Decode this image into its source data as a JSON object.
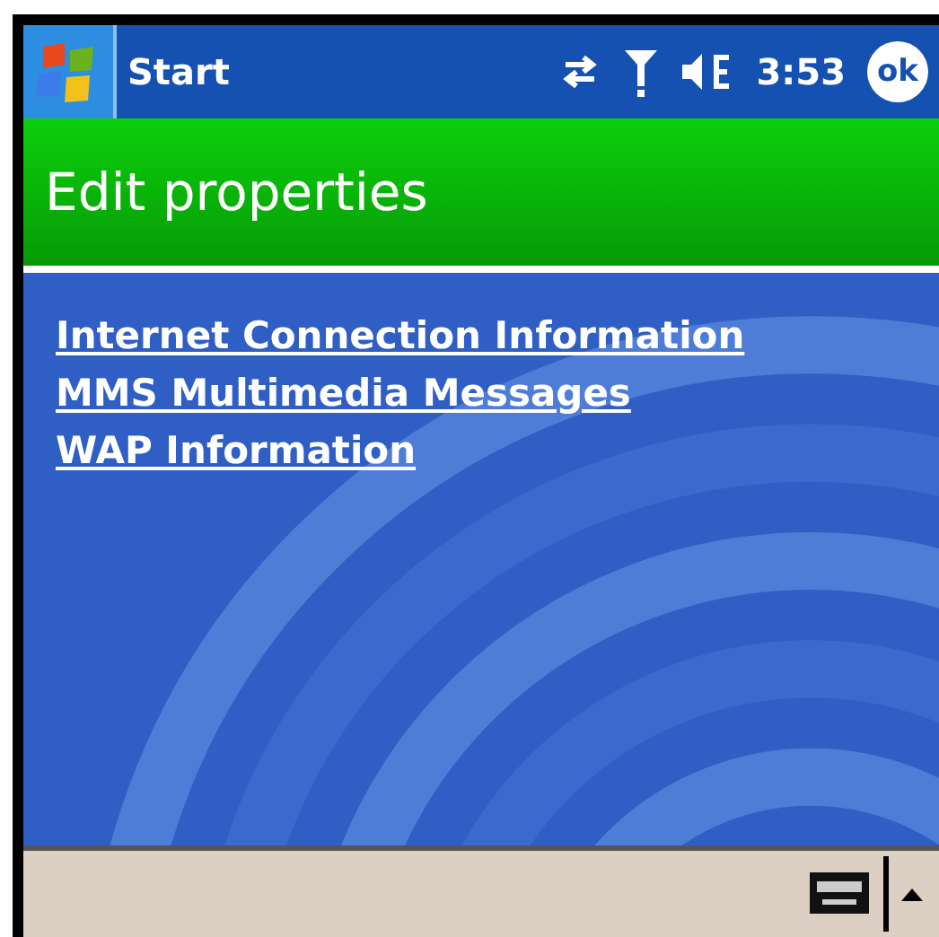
{
  "taskbar": {
    "start_label": "Start",
    "time": "3:53",
    "ok_label": "ok"
  },
  "header": {
    "title": "Edit properties"
  },
  "links": [
    {
      "label": "Internet Connection Information"
    },
    {
      "label": "MMS Multimedia Messages"
    },
    {
      "label": "WAP Information"
    }
  ]
}
